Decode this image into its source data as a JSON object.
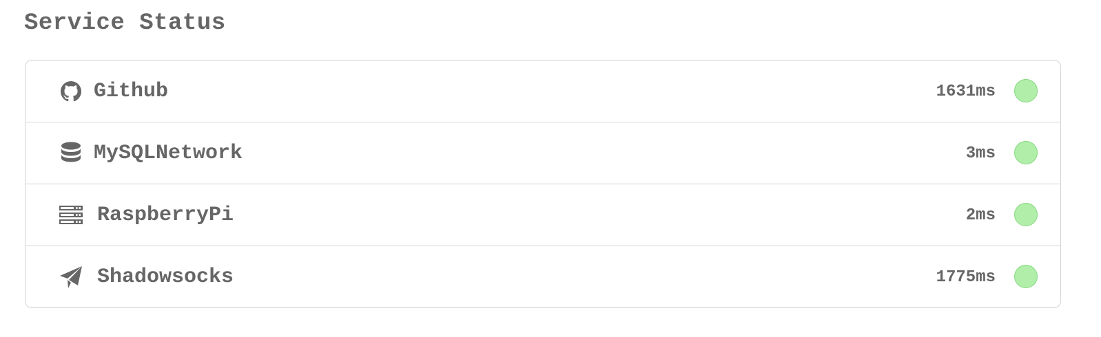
{
  "page": {
    "title": "Service Status"
  },
  "status_colors": {
    "up": "#b0eeaa",
    "up_border": "#86d97e"
  },
  "services": [
    {
      "name": "Github",
      "latency": "1631ms",
      "icon": "github-icon",
      "status": "up"
    },
    {
      "name": "MySQLNetwork",
      "latency": "3ms",
      "icon": "database-icon",
      "status": "up"
    },
    {
      "name": "RaspberryPi",
      "latency": "2ms",
      "icon": "server-icon",
      "status": "up"
    },
    {
      "name": "Shadowsocks",
      "latency": "1775ms",
      "icon": "paper-plane-icon",
      "status": "up"
    }
  ]
}
